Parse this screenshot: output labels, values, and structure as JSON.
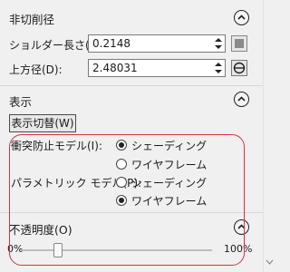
{
  "cut_diameter": {
    "title": "非切削径",
    "shoulder_length_label": "ショルダー長さ(E):",
    "shoulder_length_value": "0.2148",
    "top_diameter_label": "上方径(D):",
    "top_diameter_value": "2.48031"
  },
  "display": {
    "title": "表示",
    "toggle_button": "表示切替(W)",
    "collision_label": "衝突防止モデル(I):",
    "parametric_label": "パラメトリック モデル(P):",
    "option_shading": "シェーディング",
    "option_wireframe": "ワイヤフレーム",
    "collision_selected": "shading",
    "parametric_selected": "wireframe"
  },
  "opacity": {
    "title": "不透明度(O)",
    "min_label": "0%",
    "max_label": "100%",
    "value_fraction": 0.2
  },
  "colors": {
    "highlight": "#d8333b"
  }
}
